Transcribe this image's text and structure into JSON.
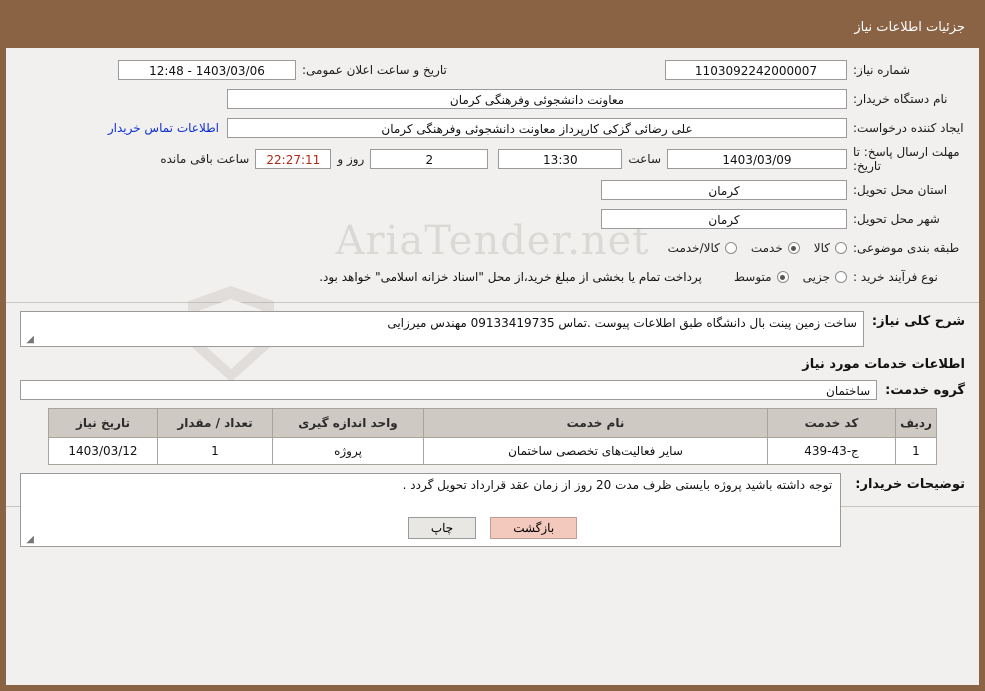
{
  "header": {
    "title": "جزئیات اطلاعات نیاز"
  },
  "watermark": {
    "text": "AriaTender.net"
  },
  "form": {
    "need_number_label": "شماره نیاز:",
    "need_number_value": "1103092242000007",
    "announce_datetime_label": "تاریخ و ساعت اعلان عمومی:",
    "announce_datetime_value": "1403/03/06 - 12:48",
    "buyer_org_label": "نام دستگاه خریدار:",
    "buyer_org_value": "معاونت دانشجوئی وفرهنگی کرمان",
    "creator_label": "ایجاد کننده درخواست:",
    "creator_value": "علی رضائی گزکی کارپرداز معاونت دانشجوئی وفرهنگی کرمان",
    "contact_link": "اطلاعات تماس خریدار",
    "deadline_label": "مهلت ارسال پاسخ: تا تاریخ:",
    "deadline_date": "1403/03/09",
    "hour_label": "ساعت",
    "deadline_time": "13:30",
    "days_value": "2",
    "days_label": "روز و",
    "remaining_time": "22:27:11",
    "remaining_label": "ساعت باقی مانده",
    "province_label": "استان محل تحویل:",
    "province_value": "کرمان",
    "city_label": "شهر محل تحویل:",
    "city_value": "کرمان",
    "category_label": "طبقه بندی موضوعی:",
    "category_options": [
      {
        "label": "کالا",
        "selected": false
      },
      {
        "label": "خدمت",
        "selected": true
      },
      {
        "label": "کالا/خدمت",
        "selected": false
      }
    ],
    "process_label": "نوع فرآیند خرید :",
    "process_options": [
      {
        "label": "جزیی",
        "selected": false
      },
      {
        "label": "متوسط",
        "selected": true
      }
    ],
    "payment_note": "پرداخت تمام یا بخشی از مبلغ خرید،از محل \"اسناد خزانه اسلامی\" خواهد بود."
  },
  "description": {
    "label": "شرح کلی نیاز:",
    "value": "ساخت زمین پینت بال دانشگاه طبق اطلاعات پیوست .تماس 09133419735 مهندس میرزایی"
  },
  "services": {
    "heading": "اطلاعات خدمات مورد نیاز",
    "group_label": "گروه خدمت:",
    "group_value": "ساختمان",
    "columns": [
      "ردیف",
      "کد خدمت",
      "نام خدمت",
      "واحد اندازه گیری",
      "تعداد / مقدار",
      "تاریخ نیاز"
    ],
    "rows": [
      {
        "index": "1",
        "code": "ج-43-439",
        "name": "سایر فعالیت‌های تخصصی ساختمان",
        "unit": "پروژه",
        "quantity": "1",
        "date": "1403/03/12"
      }
    ]
  },
  "buyer_notes": {
    "label": "توضیحات خریدار:",
    "value": "توجه داشته باشید پروژه بایستی ظرف مدت 20 روز از زمان عقد قرارداد تحویل گردد ."
  },
  "footer": {
    "print_label": "چاپ",
    "back_label": "بازگشت"
  }
}
